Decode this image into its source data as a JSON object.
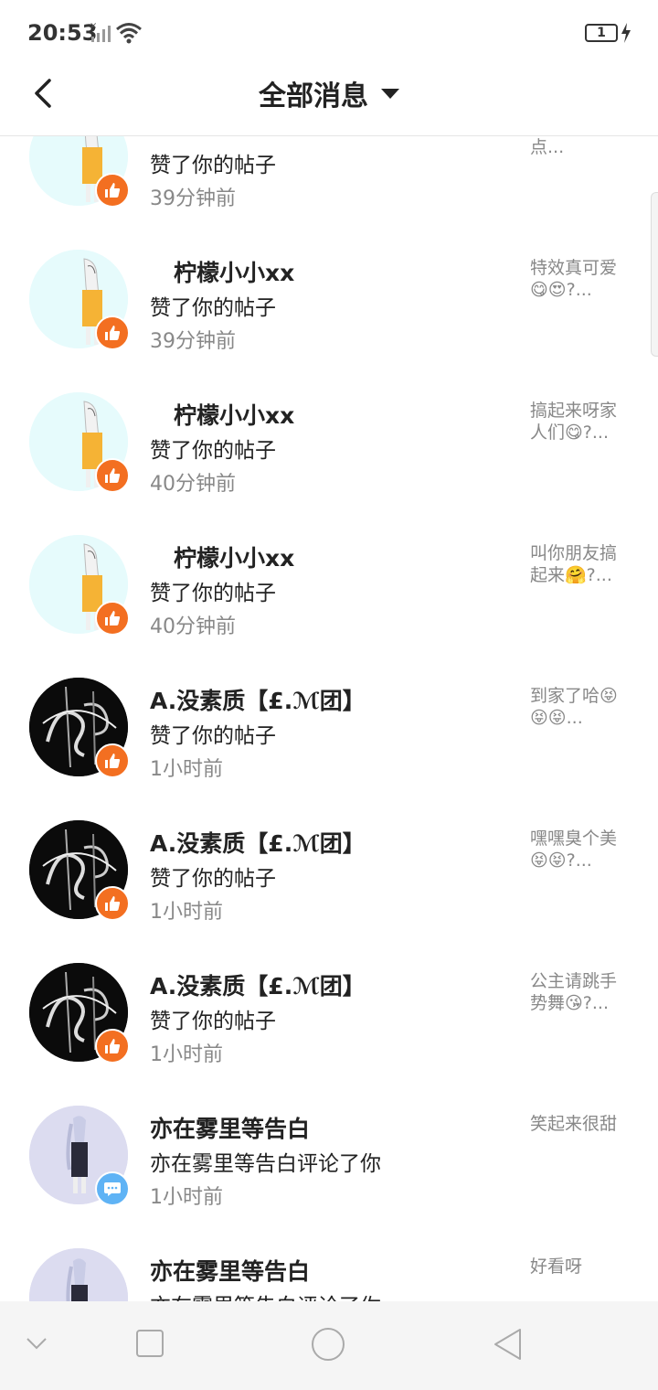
{
  "status_bar": {
    "time": "20:53",
    "battery": "1"
  },
  "header": {
    "title": "全部消息"
  },
  "notifications": [
    {
      "name": "",
      "action": "赞了你的帖子",
      "time": "39分钟前",
      "preview": "能不能多点...",
      "avatar": "light",
      "badge": "like-icon"
    },
    {
      "name": "柠檬小小xx",
      "action": "赞了你的帖子",
      "time": "39分钟前",
      "preview": "特效真可爱😋😍?...",
      "avatar": "light",
      "badge": "like-icon"
    },
    {
      "name": "柠檬小小xx",
      "action": "赞了你的帖子",
      "time": "40分钟前",
      "preview": "搞起来呀家人们😋?...",
      "avatar": "light",
      "badge": "like-icon"
    },
    {
      "name": "柠檬小小xx",
      "action": "赞了你的帖子",
      "time": "40分钟前",
      "preview": "叫你朋友搞起来🤗?...",
      "avatar": "light",
      "badge": "like-icon"
    },
    {
      "name": "A.没素质【£.ℳ团】",
      "action": "赞了你的帖子",
      "time": "1小时前",
      "preview": "到家了哈😝😝😝...",
      "avatar": "dark",
      "badge": "like-icon"
    },
    {
      "name": "A.没素质【£.ℳ团】",
      "action": "赞了你的帖子",
      "time": "1小时前",
      "preview": "嘿嘿臭个美😝😝?...",
      "avatar": "dark",
      "badge": "like-icon"
    },
    {
      "name": "A.没素质【£.ℳ团】",
      "action": "赞了你的帖子",
      "time": "1小时前",
      "preview": "公主请跳手势舞😘?...",
      "avatar": "dark",
      "badge": "like-icon"
    },
    {
      "name": "亦在雾里等告白",
      "action": "亦在雾里等告白评论了你",
      "time": "1小时前",
      "preview": "笑起来很甜",
      "avatar": "lavender",
      "badge": "comment-icon"
    },
    {
      "name": "亦在雾里等告白",
      "action": "亦在雾里等告白评论了你",
      "time": "",
      "preview": "好看呀",
      "avatar": "lavender",
      "badge": "comment-icon"
    }
  ],
  "colors": {
    "like_badge": "#f36f21",
    "comment_badge": "#5fb3f5",
    "secondary_text": "#888888"
  }
}
